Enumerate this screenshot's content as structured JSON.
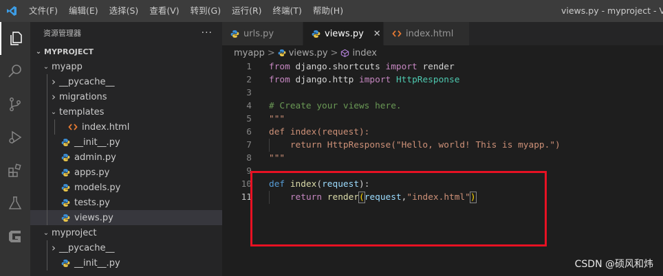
{
  "titlebar": {
    "menu": [
      "文件(F)",
      "编辑(E)",
      "选择(S)",
      "查看(V)",
      "转到(G)",
      "运行(R)",
      "终端(T)",
      "帮助(H)"
    ],
    "window_title": "views.py - myproject - Visu"
  },
  "sidebar": {
    "header": "资源管理器",
    "more": "···",
    "items": [
      {
        "label": "MYPROJECT",
        "chevron": "⌄",
        "icon": "",
        "depth": 0,
        "bold": true
      },
      {
        "label": "myapp",
        "chevron": "⌄",
        "icon": "",
        "depth": 1
      },
      {
        "label": "__pycache__",
        "chevron": "›",
        "icon": "",
        "depth": 2
      },
      {
        "label": "migrations",
        "chevron": "›",
        "icon": "",
        "depth": 2
      },
      {
        "label": "templates",
        "chevron": "⌄",
        "icon": "",
        "depth": 2
      },
      {
        "label": "index.html",
        "chevron": "",
        "icon": "html",
        "depth": 3
      },
      {
        "label": "__init__.py",
        "chevron": "",
        "icon": "python",
        "depth": 2
      },
      {
        "label": "admin.py",
        "chevron": "",
        "icon": "python",
        "depth": 2
      },
      {
        "label": "apps.py",
        "chevron": "",
        "icon": "python",
        "depth": 2
      },
      {
        "label": "models.py",
        "chevron": "",
        "icon": "python",
        "depth": 2
      },
      {
        "label": "tests.py",
        "chevron": "",
        "icon": "python",
        "depth": 2
      },
      {
        "label": "views.py",
        "chevron": "",
        "icon": "python",
        "depth": 2,
        "selected": true
      },
      {
        "label": "myproject",
        "chevron": "⌄",
        "icon": "",
        "depth": 1
      },
      {
        "label": "__pycache__",
        "chevron": "›",
        "icon": "",
        "depth": 2
      },
      {
        "label": "__init__.py",
        "chevron": "",
        "icon": "python",
        "depth": 2
      }
    ]
  },
  "tabs": [
    {
      "label": "urls.py",
      "icon": "python",
      "active": false
    },
    {
      "label": "views.py",
      "icon": "python",
      "active": true,
      "close": "✕"
    },
    {
      "label": "index.html",
      "icon": "html",
      "active": false
    }
  ],
  "breadcrumb": {
    "folder": "myapp",
    "file": "views.py",
    "symbol": "index",
    "sep": ">"
  },
  "code": [
    {
      "n": "1",
      "tokens": [
        [
          "kw2",
          "from"
        ],
        [
          "plain",
          " django."
        ],
        [
          "plain",
          "shortcuts "
        ],
        [
          "kw2",
          "import"
        ],
        [
          "plain",
          " render"
        ]
      ]
    },
    {
      "n": "2",
      "tokens": [
        [
          "kw2",
          "from"
        ],
        [
          "plain",
          " django."
        ],
        [
          "plain",
          "http "
        ],
        [
          "kw2",
          "import"
        ],
        [
          "plain",
          " "
        ],
        [
          "cls",
          "HttpResponse"
        ]
      ]
    },
    {
      "n": "3",
      "tokens": []
    },
    {
      "n": "4",
      "tokens": [
        [
          "cmt",
          "# Create your views here."
        ]
      ]
    },
    {
      "n": "5",
      "tokens": [
        [
          "str",
          "\"\"\""
        ]
      ]
    },
    {
      "n": "6",
      "tokens": [
        [
          "str",
          "def index(request):"
        ]
      ]
    },
    {
      "n": "7",
      "tokens": [
        [
          "str",
          "    return HttpResponse(\"Hello, world! This is myapp.\")"
        ]
      ],
      "guide": true
    },
    {
      "n": "8",
      "tokens": [
        [
          "str",
          "\"\"\""
        ]
      ]
    },
    {
      "n": "9",
      "tokens": []
    },
    {
      "n": "10",
      "tokens": [
        [
          "kw",
          "def"
        ],
        [
          "plain",
          " "
        ],
        [
          "fn",
          "index"
        ],
        [
          "plain",
          "("
        ],
        [
          "prm",
          "request"
        ],
        [
          "plain",
          "):"
        ]
      ]
    },
    {
      "n": "11",
      "tokens": [
        [
          "plain",
          "    "
        ],
        [
          "kw2",
          "return"
        ],
        [
          "plain",
          " "
        ],
        [
          "fn",
          "render"
        ],
        [
          "br",
          "("
        ],
        [
          "prm",
          "request"
        ],
        [
          "plain",
          ","
        ],
        [
          "str",
          "\"index.html\""
        ],
        [
          "br",
          ")"
        ]
      ],
      "current": true,
      "guide": true
    }
  ],
  "watermark": "CSDN @硕风和炜",
  "colors": {
    "accent": "#007acc",
    "highlight_box": "#e81123",
    "python_icon": "#3b8fd6",
    "html_icon": "#e37933"
  }
}
